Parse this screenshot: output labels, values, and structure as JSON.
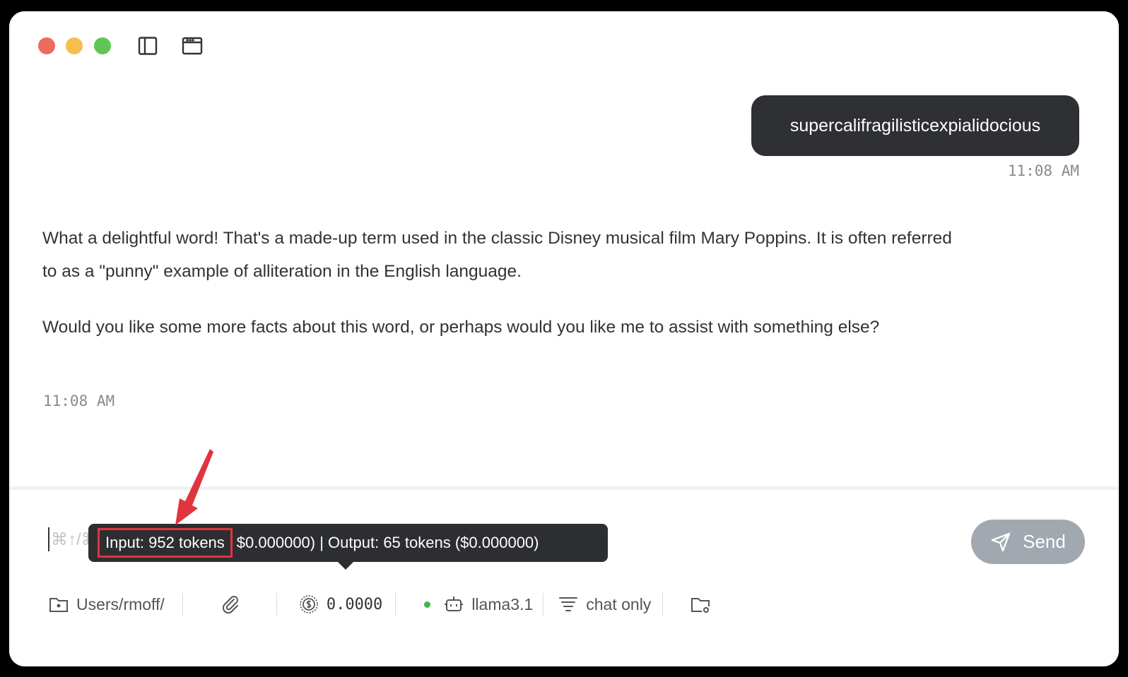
{
  "conversation": {
    "user_message": "supercalifragilisticexpialidocious",
    "user_time": "11:08 AM",
    "assistant_paragraphs": [
      "What a delightful word! That's a made-up term used in the classic Disney musical film Mary Poppins. It is often referred to as a \"punny\" example of alliteration in the English language.",
      "Would you like some more facts about this word, or perhaps would you like me to assist with something else?"
    ],
    "assistant_time": "11:08 AM"
  },
  "composer": {
    "placeholder": "⌘↑/⌘↓ to navigate messages",
    "send_label": "Send"
  },
  "tooltip": {
    "input_tokens": "Input: 952 tokens",
    "rest": "$0.000000) | Output: 65 tokens ($0.000000)"
  },
  "statusbar": {
    "folder": "Users/rmoff/",
    "cost": "0.0000",
    "model": "llama3.1",
    "mode": "chat only"
  },
  "colors": {
    "accent_dark": "#2f3033",
    "send_disabled": "#a2a8b0",
    "highlight_red": "#e0343f",
    "status_green": "#3fb34f"
  }
}
